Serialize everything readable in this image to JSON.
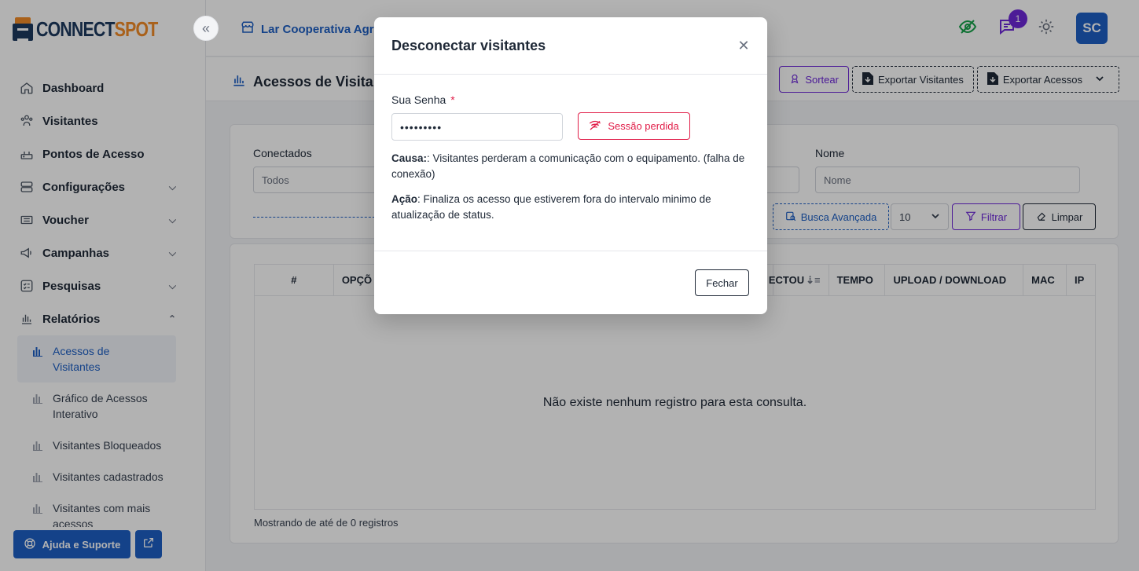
{
  "brand": {
    "name_part1": "CONNECT",
    "name_part2": "SPOT"
  },
  "topbar": {
    "organization": "Lar Cooperativa Agro",
    "notifications_count": "1",
    "avatar_initials": "SC"
  },
  "sidebar": {
    "items": [
      {
        "label": "Dashboard"
      },
      {
        "label": "Visitantes"
      },
      {
        "label": "Pontos de Acesso"
      },
      {
        "label": "Configurações"
      },
      {
        "label": "Voucher"
      },
      {
        "label": "Campanhas"
      },
      {
        "label": "Pesquisas"
      },
      {
        "label": "Relatórios"
      }
    ],
    "reports_sub": [
      {
        "label": "Acessos de Visitantes"
      },
      {
        "label": "Gráfico de Acessos Interativo"
      },
      {
        "label": "Visitantes Bloqueados"
      },
      {
        "label": "Visitantes cadastrados"
      },
      {
        "label": "Visitantes com mais acessos"
      }
    ],
    "help_label": "Ajuda e Suporte"
  },
  "page": {
    "title": "Acessos de Visitan",
    "buttons": {
      "sortear": "Sortear",
      "export_visitors": "Exportar Visitantes",
      "export_access": "Exportar Acessos"
    }
  },
  "filters": {
    "conectados_label": "Conectados",
    "conectados_value": "Todos",
    "nome_label": "Nome",
    "nome_placeholder": "Nome",
    "advanced_search": "Busca Avançada",
    "page_size": "10",
    "filter_btn": "Filtrar",
    "clear_btn": "Limpar"
  },
  "table": {
    "headers": [
      "#",
      "OPÇÕ",
      "ECTOU",
      "TEMPO",
      "UPLOAD / DOWNLOAD",
      "MAC",
      "IP"
    ],
    "empty_message": "Não existe nenhum registro para esta consulta.",
    "footer": "Mostrando de até de 0 registros"
  },
  "modal": {
    "title": "Desconectar visitantes",
    "password_label": "Sua Senha",
    "required_mark": "*",
    "password_value": "•••••••••",
    "lost_session_btn": "Sessão perdida",
    "cause_label": "Causa:",
    "cause_text": ": Visitantes perderam a comunicação com o equipamento. (falha de conexão)",
    "action_label": "Ação",
    "action_text": ": Finaliza os acesso que estiverem fora do intervalo minimo de atualização de status.",
    "close_btn": "Fechar"
  }
}
